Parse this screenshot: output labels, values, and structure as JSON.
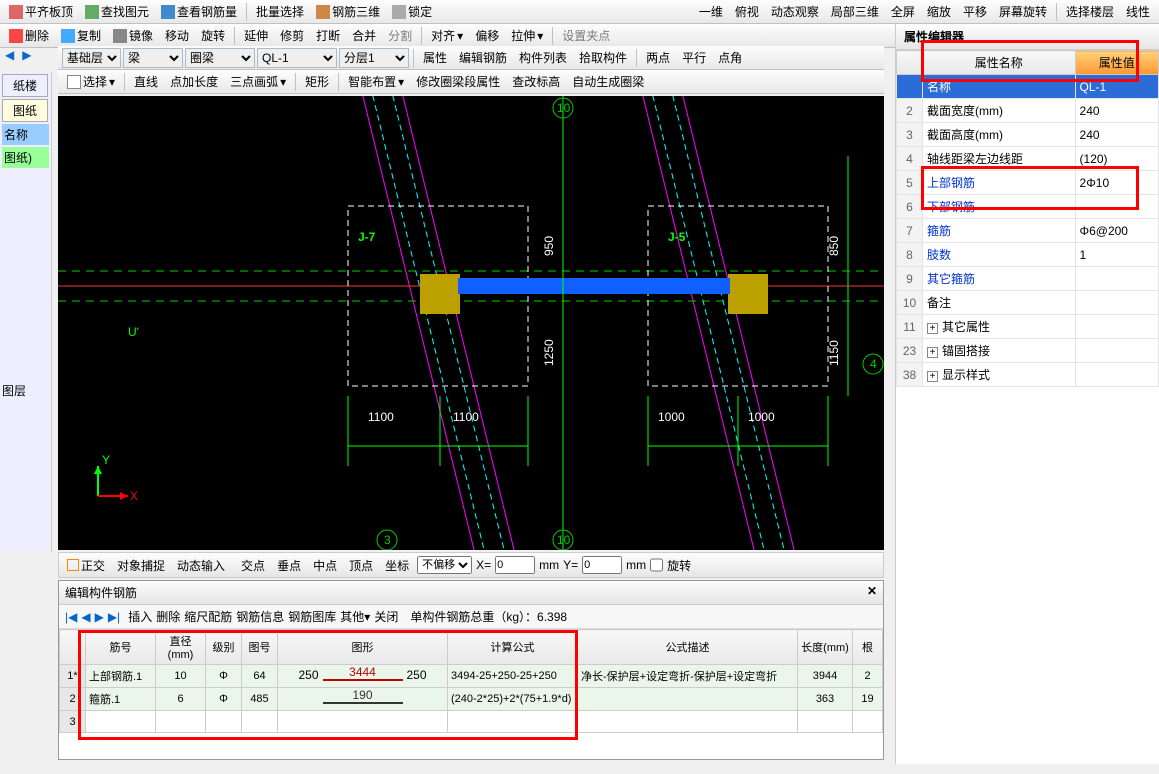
{
  "toolbar1": {
    "items": [
      "平齐板顶",
      "查找图元",
      "查看钢筋量",
      "批量选择",
      "钢筋三维",
      "锁定"
    ],
    "right": [
      "一维",
      "俯视",
      "动态观察",
      "局部三维",
      "全屏",
      "缩放",
      "平移",
      "屏幕旋转",
      "选择楼层",
      "线性"
    ]
  },
  "toolbar2": {
    "items": [
      "删除",
      "复制",
      "镜像",
      "移动",
      "旋转",
      "延伸",
      "修剪",
      "打断",
      "合并",
      "分割",
      "对齐",
      "偏移",
      "拉伸",
      "设置夹点"
    ]
  },
  "toolbar3": {
    "base_layer": "基础层",
    "cat1": "梁",
    "cat2": "圈梁",
    "member": "QL-1",
    "floor": "分层1",
    "items": [
      "属性",
      "编辑钢筋",
      "构件列表",
      "拾取构件",
      "两点",
      "平行",
      "点角"
    ]
  },
  "toolbar4": {
    "items": [
      "选择",
      "直线",
      "点加长度",
      "三点画弧",
      "矩形",
      "智能布置",
      "修改圈梁段属性",
      "查改标高",
      "自动生成圈梁"
    ]
  },
  "left": {
    "paper_tab": "纸楼",
    "drawing_tab": "图纸",
    "name_hdr": "名称",
    "drawings_lbl": "图纸)",
    "layer_lbl": "图层"
  },
  "canvas": {
    "j7": "J-7",
    "j5": "J-5",
    "u_label": "U'",
    "dims": {
      "d1100a": "1100",
      "d1100b": "1100",
      "d1000a": "1000",
      "d1000b": "1000",
      "d950": "950",
      "d1250": "1250",
      "d850": "850",
      "d1150": "1150",
      "t10a": "10",
      "t10b": "10",
      "t3": "3",
      "t4": "4"
    },
    "axes": {
      "y": "Y",
      "x": "X"
    }
  },
  "status": {
    "ortho": "正交",
    "osnap": "对象捕捉",
    "dyn": "动态输入",
    "cross": "交点",
    "perp": "垂点",
    "mid": "中点",
    "top": "顶点",
    "coord": "坐标",
    "offset_sel": "不偏移",
    "x_lbl": "X=",
    "y_lbl": "Y=",
    "mm": "mm",
    "rot": "旋转"
  },
  "rebar": {
    "title": "编辑构件钢筋",
    "tools": [
      "插入",
      "删除",
      "缩尺配筋",
      "钢筋信息",
      "钢筋图库",
      "其他",
      "关闭"
    ],
    "total_lbl": "单构件钢筋总重（kg）：",
    "total_val": "6.398",
    "headers": [
      "",
      "筋号",
      "直径(mm)",
      "级别",
      "图号",
      "图形",
      "计算公式",
      "公式描述",
      "长度(mm)",
      "根"
    ],
    "rows": [
      {
        "n": "1*",
        "name": "上部钢筋.1",
        "dia": "10",
        "grade": "Φ",
        "code": "64",
        "shape_l": "250",
        "shape_m": "3444",
        "shape_r": "250",
        "formula": "3494-25+250-25+250",
        "desc": "净长-保护层+设定弯折-保护层+设定弯折",
        "len": "3944",
        "cnt": "2"
      },
      {
        "n": "2",
        "name": "箍筋.1",
        "dia": "6",
        "grade": "Φ",
        "code": "485",
        "shape_l": "",
        "shape_m": "190",
        "shape_r": "",
        "formula": "(240-2*25)+2*(75+1.9*d)",
        "desc": "",
        "len": "363",
        "cnt": "19"
      },
      {
        "n": "3",
        "name": "",
        "dia": "",
        "grade": "",
        "code": "",
        "shape_l": "",
        "shape_m": "",
        "shape_r": "",
        "formula": "",
        "desc": "",
        "len": "",
        "cnt": ""
      }
    ]
  },
  "prop": {
    "title": "属性编辑器",
    "col_name": "属性名称",
    "col_val": "属性值",
    "rows": [
      {
        "n": "",
        "name": "名称",
        "val": "QL-1",
        "sel": true
      },
      {
        "n": "2",
        "name": "截面宽度(mm)",
        "val": "240"
      },
      {
        "n": "3",
        "name": "截面高度(mm)",
        "val": "240"
      },
      {
        "n": "4",
        "name": "轴线距梁左边线距",
        "val": "(120)"
      },
      {
        "n": "5",
        "name": "上部钢筋",
        "val": "2Φ10",
        "link": true
      },
      {
        "n": "6",
        "name": "下部钢筋",
        "val": "",
        "link": true
      },
      {
        "n": "7",
        "name": "箍筋",
        "val": "Φ6@200",
        "link": true
      },
      {
        "n": "8",
        "name": "肢数",
        "val": "1",
        "link": true
      },
      {
        "n": "9",
        "name": "其它箍筋",
        "val": "",
        "link": true
      },
      {
        "n": "10",
        "name": "备注",
        "val": ""
      },
      {
        "n": "11",
        "name": "其它属性",
        "val": "",
        "exp": true
      },
      {
        "n": "23",
        "name": "锚固搭接",
        "val": "",
        "exp": true
      },
      {
        "n": "38",
        "name": "显示样式",
        "val": "",
        "exp": true
      }
    ]
  }
}
